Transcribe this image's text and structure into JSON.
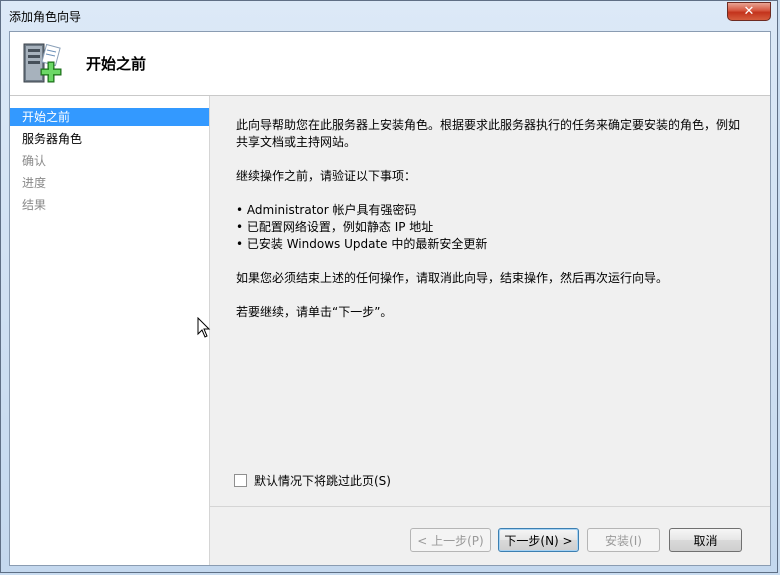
{
  "window": {
    "title": "添加角色向导",
    "close_label": "✕"
  },
  "header": {
    "title": "开始之前",
    "icon": "server-add-icon"
  },
  "nav": {
    "items": [
      {
        "label": "开始之前",
        "state": "active"
      },
      {
        "label": "服务器角色",
        "state": "available"
      },
      {
        "label": "确认",
        "state": "disabled"
      },
      {
        "label": "进度",
        "state": "disabled"
      },
      {
        "label": "结果",
        "state": "disabled"
      }
    ]
  },
  "content": {
    "intro_line1": "此向导帮助您在此服务器上安装角色。根据要求此服务器执行的任务来确定要安装的角色，例如",
    "intro_line2": "共享文档或主持网站。",
    "verify_heading": "继续操作之前，请验证以下事项：",
    "checklist": [
      "• Administrator 帐户具有强密码",
      "• 已配置网络设置，例如静态 IP 地址",
      "• 已安装 Windows Update 中的最新安全更新"
    ],
    "cancel_note": "如果您必须结束上述的任何操作，请取消此向导，结束操作，然后再次运行向导。",
    "continue_note": "若要继续，请单击“下一步”。",
    "skip_checkbox_label": "默认情况下将跳过此页(S)",
    "skip_checked": false
  },
  "buttons": {
    "prev": "< 上一步(P)",
    "next": "下一步(N) >",
    "install": "安装(I)",
    "cancel": "取消"
  }
}
